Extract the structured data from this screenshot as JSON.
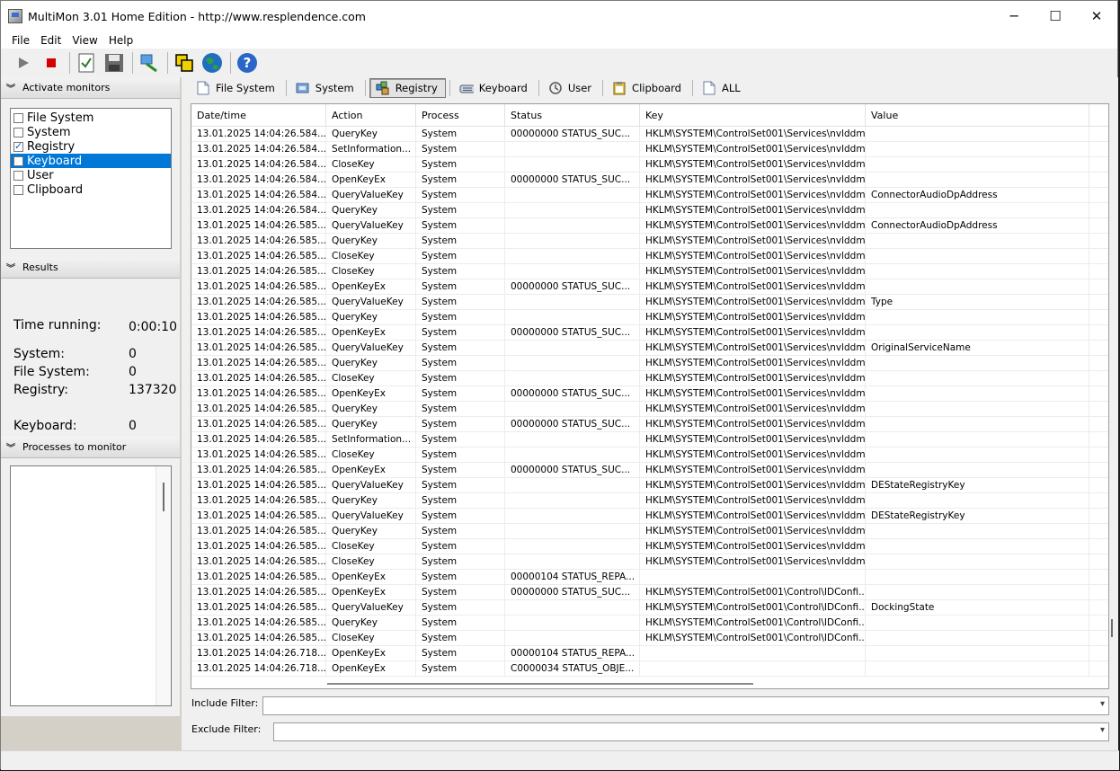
{
  "window": {
    "title": "MultiMon 3.01  Home Edition -  http://www.resplendence.com",
    "minimize": "─",
    "maximize": "☐",
    "close": "✕"
  },
  "menu": [
    "File",
    "Edit",
    "View",
    "Help"
  ],
  "toolbar": {
    "icons": [
      "play-icon",
      "stop-icon",
      "checklist-icon",
      "save-icon",
      "settings-icon",
      "window-icon",
      "globe-icon",
      "help-icon"
    ]
  },
  "left_panel": {
    "activate_monitors": {
      "title": "Activate monitors",
      "items": [
        {
          "label": "File System",
          "checked": false,
          "selected": false
        },
        {
          "label": "System",
          "checked": false,
          "selected": false
        },
        {
          "label": "Registry",
          "checked": true,
          "selected": false
        },
        {
          "label": "Keyboard",
          "checked": false,
          "selected": true
        },
        {
          "label": "User",
          "checked": false,
          "selected": false
        },
        {
          "label": "Clipboard",
          "checked": false,
          "selected": false
        }
      ]
    },
    "results": {
      "title": "Results",
      "time_running_label": "Time running:",
      "time_running_value": "0:00:10",
      "system_label": "System:",
      "system_value": "0",
      "file_system_label": "File System:",
      "file_system_value": "0",
      "registry_label": "Registry:",
      "registry_value": "137320",
      "keyboard_label": "Keyboard:",
      "keyboard_value": "0"
    },
    "processes": {
      "title": "Processes to monitor"
    }
  },
  "tabs": [
    {
      "label": "File System",
      "icon": "document-icon",
      "active": false
    },
    {
      "label": "System",
      "icon": "system-icon",
      "active": false
    },
    {
      "label": "Registry",
      "icon": "registry-icon",
      "active": true
    },
    {
      "label": "Keyboard",
      "icon": "keyboard-icon",
      "active": false
    },
    {
      "label": "User",
      "icon": "user-icon",
      "active": false
    },
    {
      "label": "Clipboard",
      "icon": "clipboard-icon",
      "active": false
    },
    {
      "label": "ALL",
      "icon": "document-icon",
      "active": false
    }
  ],
  "grid": {
    "columns": [
      "Date/time",
      "Action",
      "Process",
      "Status",
      "Key",
      "Value"
    ],
    "rows": [
      [
        "13.01.2025 14:04:26.584...",
        "QueryKey",
        "System",
        "00000000  STATUS_SUC...",
        "HKLM\\SYSTEM\\ControlSet001\\Services\\nvlddm...",
        ""
      ],
      [
        "13.01.2025 14:04:26.584...",
        "SetInformation...",
        "System",
        "",
        "HKLM\\SYSTEM\\ControlSet001\\Services\\nvlddm...",
        ""
      ],
      [
        "13.01.2025 14:04:26.584...",
        "CloseKey",
        "System",
        "",
        "HKLM\\SYSTEM\\ControlSet001\\Services\\nvlddmkm",
        ""
      ],
      [
        "13.01.2025 14:04:26.584...",
        "OpenKeyEx",
        "System",
        "00000000  STATUS_SUC...",
        "HKLM\\SYSTEM\\ControlSet001\\Services\\nvlddm...",
        ""
      ],
      [
        "13.01.2025 14:04:26.584...",
        "QueryValueKey",
        "System",
        "",
        "HKLM\\SYSTEM\\ControlSet001\\Services\\nvlddm...",
        "ConnectorAudioDpAddress"
      ],
      [
        "13.01.2025 14:04:26.584...",
        "QueryKey",
        "System",
        "",
        "HKLM\\SYSTEM\\ControlSet001\\Services\\nvlddm...",
        ""
      ],
      [
        "13.01.2025 14:04:26.585...",
        "QueryValueKey",
        "System",
        "",
        "HKLM\\SYSTEM\\ControlSet001\\Services\\nvlddm...",
        "ConnectorAudioDpAddress"
      ],
      [
        "13.01.2025 14:04:26.585...",
        "QueryKey",
        "System",
        "",
        "HKLM\\SYSTEM\\ControlSet001\\Services\\nvlddm...",
        ""
      ],
      [
        "13.01.2025 14:04:26.585...",
        "CloseKey",
        "System",
        "",
        "HKLM\\SYSTEM\\ControlSet001\\Services\\nvlddm...",
        ""
      ],
      [
        "13.01.2025 14:04:26.585...",
        "CloseKey",
        "System",
        "",
        "HKLM\\SYSTEM\\ControlSet001\\Services\\nvlddm...",
        ""
      ],
      [
        "13.01.2025 14:04:26.585...",
        "OpenKeyEx",
        "System",
        "00000000  STATUS_SUC...",
        "HKLM\\SYSTEM\\ControlSet001\\Services\\nvlddmkm",
        ""
      ],
      [
        "13.01.2025 14:04:26.585...",
        "QueryValueKey",
        "System",
        "",
        "HKLM\\SYSTEM\\ControlSet001\\Services\\nvlddmkm",
        "Type"
      ],
      [
        "13.01.2025 14:04:26.585...",
        "QueryKey",
        "System",
        "",
        "HKLM\\SYSTEM\\ControlSet001\\Services\\nvlddmkm",
        ""
      ],
      [
        "13.01.2025 14:04:26.585...",
        "OpenKeyEx",
        "System",
        "00000000  STATUS_SUC...",
        "HKLM\\SYSTEM\\ControlSet001\\Services\\nvlddmkm",
        ""
      ],
      [
        "13.01.2025 14:04:26.585...",
        "QueryValueKey",
        "System",
        "",
        "HKLM\\SYSTEM\\ControlSet001\\Services\\nvlddmkm",
        "OriginalServiceName"
      ],
      [
        "13.01.2025 14:04:26.585...",
        "QueryKey",
        "System",
        "",
        "HKLM\\SYSTEM\\ControlSet001\\Services\\nvlddmkm",
        ""
      ],
      [
        "13.01.2025 14:04:26.585...",
        "CloseKey",
        "System",
        "",
        "HKLM\\SYSTEM\\ControlSet001\\Services\\nvlddmkm",
        ""
      ],
      [
        "13.01.2025 14:04:26.585...",
        "OpenKeyEx",
        "System",
        "00000000  STATUS_SUC...",
        "HKLM\\SYSTEM\\ControlSet001\\Services\\nvlddm...",
        ""
      ],
      [
        "13.01.2025 14:04:26.585...",
        "QueryKey",
        "System",
        "",
        "HKLM\\SYSTEM\\ControlSet001\\Services\\nvlddm...",
        ""
      ],
      [
        "13.01.2025 14:04:26.585...",
        "QueryKey",
        "System",
        "00000000  STATUS_SUC...",
        "HKLM\\SYSTEM\\ControlSet001\\Services\\nvlddm...",
        ""
      ],
      [
        "13.01.2025 14:04:26.585...",
        "SetInformation...",
        "System",
        "",
        "HKLM\\SYSTEM\\ControlSet001\\Services\\nvlddm...",
        ""
      ],
      [
        "13.01.2025 14:04:26.585...",
        "CloseKey",
        "System",
        "",
        "HKLM\\SYSTEM\\ControlSet001\\Services\\nvlddmkm",
        ""
      ],
      [
        "13.01.2025 14:04:26.585...",
        "OpenKeyEx",
        "System",
        "00000000  STATUS_SUC...",
        "HKLM\\SYSTEM\\ControlSet001\\Services\\nvlddm...",
        ""
      ],
      [
        "13.01.2025 14:04:26.585...",
        "QueryValueKey",
        "System",
        "",
        "HKLM\\SYSTEM\\ControlSet001\\Services\\nvlddm...",
        "DEStateRegistryKey"
      ],
      [
        "13.01.2025 14:04:26.585...",
        "QueryKey",
        "System",
        "",
        "HKLM\\SYSTEM\\ControlSet001\\Services\\nvlddm...",
        ""
      ],
      [
        "13.01.2025 14:04:26.585...",
        "QueryValueKey",
        "System",
        "",
        "HKLM\\SYSTEM\\ControlSet001\\Services\\nvlddm...",
        "DEStateRegistryKey"
      ],
      [
        "13.01.2025 14:04:26.585...",
        "QueryKey",
        "System",
        "",
        "HKLM\\SYSTEM\\ControlSet001\\Services\\nvlddm...",
        ""
      ],
      [
        "13.01.2025 14:04:26.585...",
        "CloseKey",
        "System",
        "",
        "HKLM\\SYSTEM\\ControlSet001\\Services\\nvlddm...",
        ""
      ],
      [
        "13.01.2025 14:04:26.585...",
        "CloseKey",
        "System",
        "",
        "HKLM\\SYSTEM\\ControlSet001\\Services\\nvlddm...",
        ""
      ],
      [
        "13.01.2025 14:04:26.585...",
        "OpenKeyEx",
        "System",
        "00000104  STATUS_REPA...",
        "",
        ""
      ],
      [
        "13.01.2025 14:04:26.585...",
        "OpenKeyEx",
        "System",
        "00000000  STATUS_SUC...",
        "HKLM\\SYSTEM\\ControlSet001\\Control\\IDConfi...",
        ""
      ],
      [
        "13.01.2025 14:04:26.585...",
        "QueryValueKey",
        "System",
        "",
        "HKLM\\SYSTEM\\ControlSet001\\Control\\IDConfi...",
        "DockingState"
      ],
      [
        "13.01.2025 14:04:26.585...",
        "QueryKey",
        "System",
        "",
        "HKLM\\SYSTEM\\ControlSet001\\Control\\IDConfi...",
        ""
      ],
      [
        "13.01.2025 14:04:26.585...",
        "CloseKey",
        "System",
        "",
        "HKLM\\SYSTEM\\ControlSet001\\Control\\IDConfi...",
        ""
      ],
      [
        "13.01.2025 14:04:26.718...",
        "OpenKeyEx",
        "System",
        "00000104  STATUS_REPA...",
        "",
        ""
      ],
      [
        "13.01.2025 14:04:26.718...",
        "OpenKeyEx",
        "System",
        "C0000034  STATUS_OBJE...",
        "",
        ""
      ]
    ]
  },
  "filters": {
    "include_label": "Include Filter:",
    "include_value": "",
    "exclude_label": "Exclude Filter:",
    "exclude_value": ""
  }
}
